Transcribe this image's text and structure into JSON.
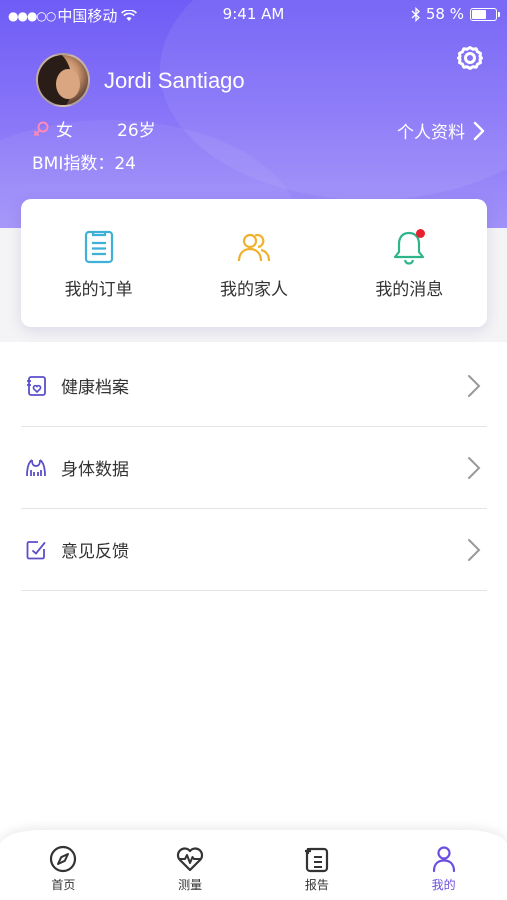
{
  "status_bar": {
    "signal": "●●●○○",
    "carrier": "中国移动",
    "time": "9:41 AM",
    "battery_text": "58 %",
    "bluetooth_icon": "bluetooth-icon",
    "wifi_icon": "wifi-icon"
  },
  "profile": {
    "name": "Jordi Santiago",
    "gender": "女",
    "age": "26岁",
    "bmi": "BMI指数：24",
    "profile_link": "个人资料"
  },
  "quick_actions": [
    {
      "label": "我的订单",
      "icon": "order-list-icon",
      "color": "#3fb1d9"
    },
    {
      "label": "我的家人",
      "icon": "family-icon",
      "color": "#f0b12c"
    },
    {
      "label": "我的消息",
      "icon": "bell-icon",
      "color": "#2fb58c",
      "badge": true
    }
  ],
  "menu": [
    {
      "label": "健康档案",
      "icon": "health-record-icon"
    },
    {
      "label": "身体数据",
      "icon": "body-data-icon"
    },
    {
      "label": "意见反馈",
      "icon": "feedback-icon"
    }
  ],
  "tabs": [
    {
      "label": "首页",
      "icon": "compass-icon",
      "active": false
    },
    {
      "label": "测量",
      "icon": "heart-pulse-icon",
      "active": false
    },
    {
      "label": "报告",
      "icon": "report-icon",
      "active": false
    },
    {
      "label": "我的",
      "icon": "person-icon",
      "active": true
    }
  ],
  "colors": {
    "accent": "#6c4fe0",
    "header_start": "#6f5cf6",
    "header_end": "#a192f9",
    "badge": "#e7212e"
  }
}
